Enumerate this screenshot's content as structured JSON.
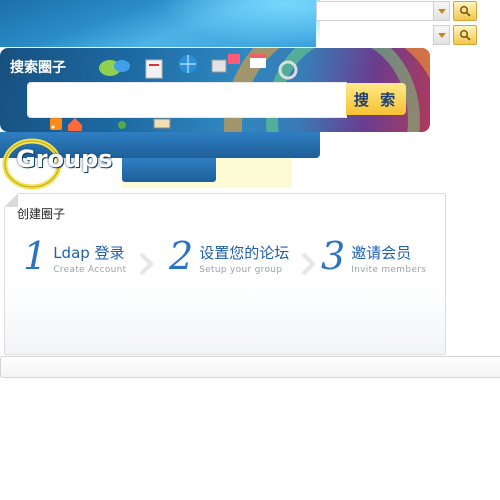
{
  "search": {
    "title": "搜索圈子",
    "button_label": "搜 索",
    "placeholder": ""
  },
  "logo": {
    "text": "Groups"
  },
  "create": {
    "title": "创建圈子",
    "steps": [
      {
        "num": "1",
        "label": "Ldap 登录",
        "sub": "Create Account"
      },
      {
        "num": "2",
        "label": "设置您的论坛",
        "sub": "Setup your group"
      },
      {
        "num": "3",
        "label": "邀请会员",
        "sub": "Invite members"
      }
    ]
  },
  "colors": {
    "accent_blue": "#2a73c5",
    "button_yellow": "#f6c232",
    "logo_bar_blue": "#1e5f99"
  },
  "icons": [
    "search-icon",
    "dropdown-arrow-icon",
    "chat-bubble-icon",
    "globe-icon",
    "rss-icon",
    "home-icon",
    "chevron-right-icon"
  ]
}
